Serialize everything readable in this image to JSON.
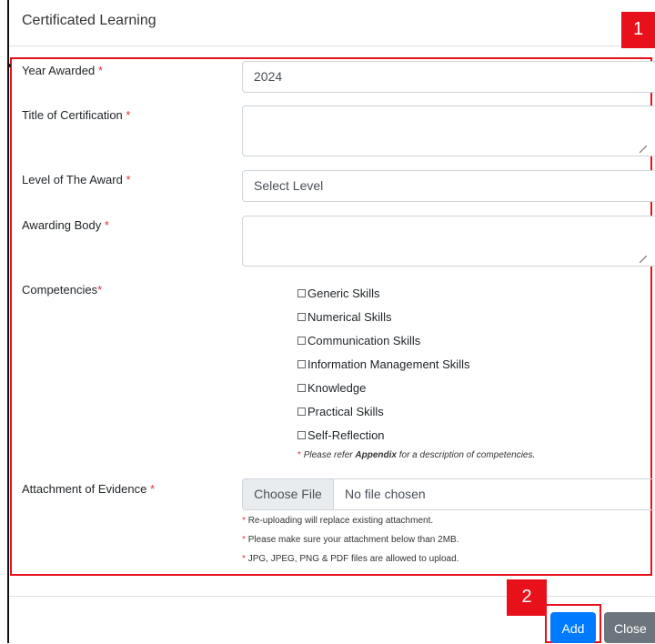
{
  "modal": {
    "title": "Certificated Learning"
  },
  "annotations": {
    "badge1": "1",
    "badge2": "2"
  },
  "form": {
    "year_awarded": {
      "label": "Year Awarded",
      "required": "*",
      "value": "2024"
    },
    "title_of_certification": {
      "label": "Title of Certification",
      "required": "*",
      "value": ""
    },
    "level_of_award": {
      "label": "Level of The Award",
      "required": "*",
      "value": "Select Level"
    },
    "awarding_body": {
      "label": "Awarding Body",
      "required": "*",
      "value": ""
    },
    "competencies": {
      "label": "Competencies",
      "required": "*",
      "options": [
        "Generic Skills",
        "Numerical Skills",
        "Communication Skills",
        "Information Management Skills",
        "Knowledge",
        "Practical Skills",
        "Self-Reflection"
      ],
      "note_star": "*",
      "note_prefix": "Please refer",
      "note_link": "Appendix",
      "note_suffix": "for a description of competencies."
    },
    "attachment": {
      "label": "Attachment of Evidence",
      "required": "*",
      "button": "Choose File",
      "status": "No file chosen",
      "notes": [
        "Re-uploading will replace existing attachment.",
        "Please make sure your attachment below than 2MB.",
        "JPG, JPEG, PNG & PDF files are allowed to upload."
      ],
      "note_star": "*"
    }
  },
  "footer": {
    "add": "Add",
    "close": "Close"
  },
  "colors": {
    "required": "#dc3545",
    "annotation": "#e8101a",
    "primary": "#007bff",
    "secondary": "#6c757d"
  }
}
